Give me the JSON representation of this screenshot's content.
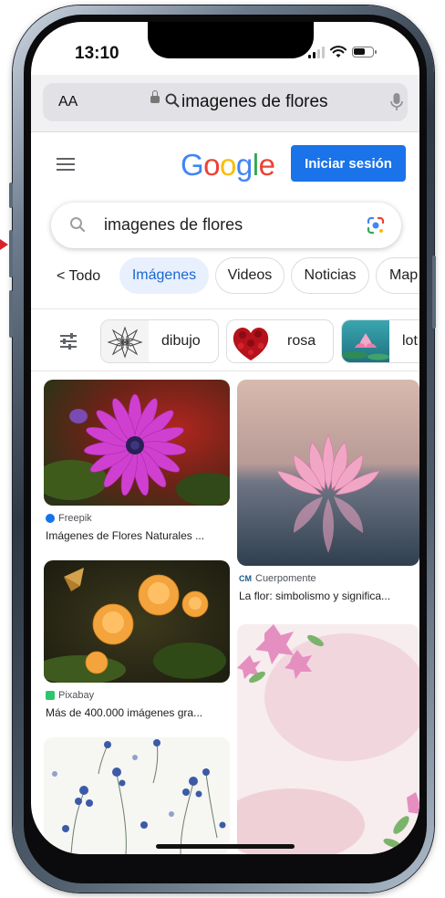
{
  "status_bar": {
    "time": "13:10"
  },
  "browser": {
    "text_size_label": "AA",
    "url_text": "imagenes de flores"
  },
  "header": {
    "logo_letters": [
      "G",
      "o",
      "o",
      "g",
      "l",
      "e"
    ],
    "signin_label": "Iniciar sesión"
  },
  "search": {
    "query": "imagenes de flores"
  },
  "tabs": {
    "back_label": "Todo",
    "items": [
      "Imágenes",
      "Videos",
      "Noticias",
      "Map"
    ],
    "active": "Imágenes"
  },
  "suggestions": [
    {
      "label": "dibujo"
    },
    {
      "label": "rosa"
    },
    {
      "label": "lot"
    }
  ],
  "results": [
    {
      "source": "Freepik",
      "title": "Imágenes de Flores Naturales ..."
    },
    {
      "source": "Cuerpomente",
      "title": "La flor: simbolismo y significa..."
    },
    {
      "source": "Pixabay",
      "title": "Más de 400.000 imágenes gra..."
    },
    {
      "source": "",
      "title": ""
    },
    {
      "source": "",
      "title": ""
    }
  ],
  "colors": {
    "accent": "#1a73e8",
    "chip_active_bg": "#e8f0fe",
    "chip_active_text": "#1967d2"
  }
}
